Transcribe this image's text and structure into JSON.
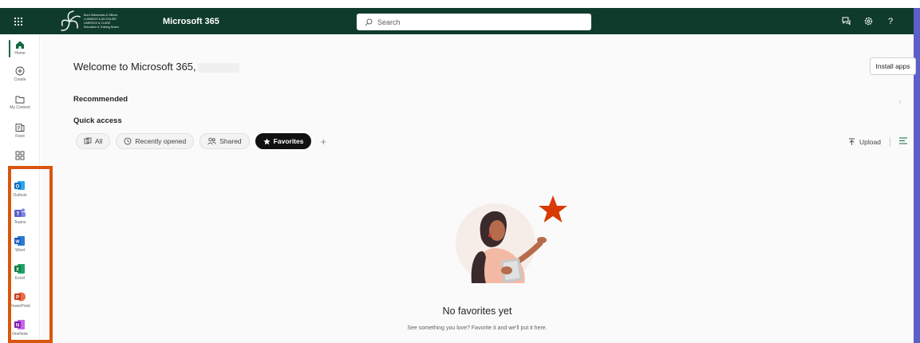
{
  "topbar": {
    "app_launcher_icon": "waffle-icon",
    "org_logo_lines": [
      "Bord Oideachais & Oiliúna",
      "LUIMNIGH & AN CHLÁIR",
      "LIMERICK & CLARE",
      "Education & Training Board"
    ],
    "app_name": "Microsoft 365",
    "search_placeholder": "Search",
    "icons": [
      "feedback-icon",
      "settings-icon",
      "help-icon"
    ],
    "help_label": "?",
    "background_color": "#0f3b2d"
  },
  "rail": {
    "items": [
      {
        "label": "Home",
        "icon": "home-icon",
        "active": true
      },
      {
        "label": "Create",
        "icon": "create-icon"
      },
      {
        "label": "My Content",
        "icon": "folder-icon"
      },
      {
        "label": "Feed",
        "icon": "feed-icon"
      },
      {
        "label": "",
        "icon": "apps-icon"
      }
    ],
    "apps": [
      {
        "label": "Outlook",
        "icon": "outlook-icon",
        "letter": "O",
        "color": "#0f6cbd"
      },
      {
        "label": "Teams",
        "icon": "teams-icon",
        "letter": "T",
        "color": "#5b5fc7"
      },
      {
        "label": "Word",
        "icon": "word-icon",
        "letter": "W",
        "color": "#185abd"
      },
      {
        "label": "Excel",
        "icon": "excel-icon",
        "letter": "X",
        "color": "#107c41"
      },
      {
        "label": "PowerPoint",
        "icon": "powerpoint-icon",
        "letter": "P",
        "color": "#c43e1c"
      },
      {
        "label": "OneNote",
        "icon": "onenote-icon",
        "letter": "N",
        "color": "#7719aa"
      }
    ],
    "highlight_color": "#d8560f"
  },
  "main": {
    "welcome": "Welcome to Microsoft 365,",
    "install_apps": "Install apps",
    "recommended": "Recommended",
    "quick_access": "Quick access",
    "filters": [
      {
        "label": "All",
        "icon": "all-files-icon",
        "active": false
      },
      {
        "label": "Recently opened",
        "icon": "clock-icon",
        "active": false
      },
      {
        "label": "Shared",
        "icon": "people-icon",
        "active": false
      },
      {
        "label": "Favorites",
        "icon": "star-icon",
        "active": true
      }
    ],
    "add_label": "+",
    "upload": "Upload",
    "empty_title": "No favorites yet",
    "empty_subtitle": "See something you love? Favorite it and we'll put it here."
  }
}
